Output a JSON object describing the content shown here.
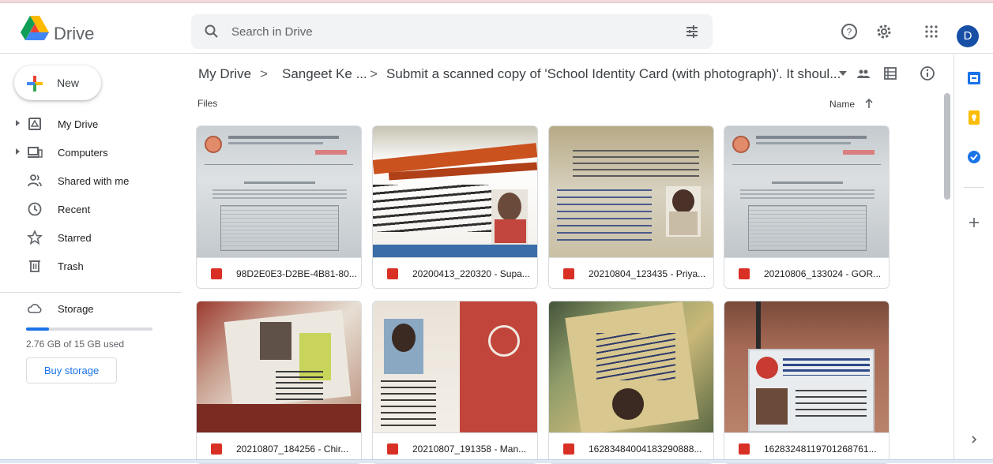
{
  "app": {
    "name": "Drive"
  },
  "search": {
    "placeholder": "Search in Drive"
  },
  "account": {
    "initial": "D"
  },
  "sidebar": {
    "new_label": "New",
    "items": [
      {
        "label": "My Drive",
        "icon": "drive-icon",
        "expandable": true
      },
      {
        "label": "Computers",
        "icon": "computer-icon",
        "expandable": true
      },
      {
        "label": "Shared with me",
        "icon": "people-icon",
        "expandable": false
      },
      {
        "label": "Recent",
        "icon": "clock-icon",
        "expandable": false
      },
      {
        "label": "Starred",
        "icon": "star-icon",
        "expandable": false
      },
      {
        "label": "Trash",
        "icon": "trash-icon",
        "expandable": false
      }
    ],
    "storage": {
      "label": "Storage",
      "used_text": "2.76 GB of 15 GB used",
      "used_fraction": 0.184,
      "buy_label": "Buy storage"
    }
  },
  "breadcrumb": {
    "items": [
      "My Drive",
      "Sangeet Ke ...",
      "Submit a scanned copy of 'School Identity Card (with photograph)'. It shoul..."
    ],
    "separator": ">"
  },
  "files": {
    "section_label": "Files",
    "sort_label": "Name",
    "items": [
      {
        "name": "98D2E0E3-D2BE-4B81-80..."
      },
      {
        "name": "20200413_220320 - Supa..."
      },
      {
        "name": "20210804_123435 - Priya..."
      },
      {
        "name": "20210806_133024 - GOR..."
      },
      {
        "name": "20210807_184256 - Chir..."
      },
      {
        "name": "20210807_191358 - Man..."
      },
      {
        "name": "16283484004183290888..."
      },
      {
        "name": "16283248119701268761..."
      }
    ]
  },
  "colors": {
    "accent": "#1a73e8",
    "image_file_icon": "#d93025"
  }
}
